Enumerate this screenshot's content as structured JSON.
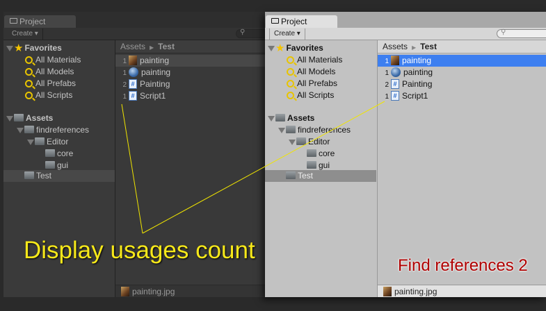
{
  "windows": [
    {
      "tab": "Project",
      "create": "Create ▾",
      "breadcrumb": {
        "root": "Assets",
        "current": "Test"
      },
      "favorites": {
        "label": "Favorites",
        "items": [
          "All Materials",
          "All Models",
          "All Prefabs",
          "All Scripts"
        ]
      },
      "assets": {
        "label": "Assets",
        "findreferences": "findreferences",
        "editor": "Editor",
        "core": "core",
        "gui": "gui",
        "test": "Test"
      },
      "files": [
        {
          "count": "1",
          "name": "painting",
          "icon": "texture-icon"
        },
        {
          "count": "1",
          "name": "painting",
          "icon": "sphere-icon"
        },
        {
          "count": "2",
          "name": "Painting",
          "icon": "csharp-script-icon"
        },
        {
          "count": "1",
          "name": "Script1",
          "icon": "csharp-script-icon"
        }
      ],
      "footer": "painting.jpg"
    },
    {
      "tab": "Project",
      "create": "Create ▾",
      "breadcrumb": {
        "root": "Assets",
        "current": "Test"
      },
      "favorites": {
        "label": "Favorites",
        "items": [
          "All Materials",
          "All Models",
          "All Prefabs",
          "All Scripts"
        ]
      },
      "assets": {
        "label": "Assets",
        "findreferences": "findreferences",
        "editor": "Editor",
        "core": "core",
        "gui": "gui",
        "test": "Test"
      },
      "files": [
        {
          "count": "1",
          "name": "painting",
          "icon": "texture-icon"
        },
        {
          "count": "1",
          "name": "painting",
          "icon": "sphere-icon"
        },
        {
          "count": "2",
          "name": "Painting",
          "icon": "csharp-script-icon"
        },
        {
          "count": "1",
          "name": "Script1",
          "icon": "csharp-script-icon"
        }
      ],
      "footer": "painting.jpg"
    }
  ],
  "captions": {
    "left": "Display usages count",
    "right": "Find references 2"
  },
  "colors": {
    "caption_left": "#f6e81a",
    "caption_right": "#b00000",
    "selection_blue": "#3d7ff0"
  }
}
